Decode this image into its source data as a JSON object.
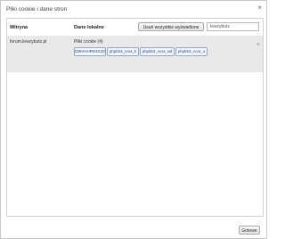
{
  "dialog": {
    "title": "Pliki cookie i dane stron",
    "close_icon": "×"
  },
  "table": {
    "header_site": "Witryna",
    "header_local_data": "Dane lokalne",
    "remove_all_label": "Usuń wszystkie wyświetlone",
    "search_value": "lewzybutz"
  },
  "rows": [
    {
      "site": "forum.lewzybutz.pl",
      "cookies_label": "Pliki cookie (4)",
      "chips": [
        "IDBVHHRD2S2D",
        "phpbb3_rvo4_k",
        "phpbb3_rvo4_sid",
        "phpbb3_rvo4_u"
      ],
      "remove_icon": "×"
    }
  ],
  "footer": {
    "done_label": "Gotowe"
  }
}
